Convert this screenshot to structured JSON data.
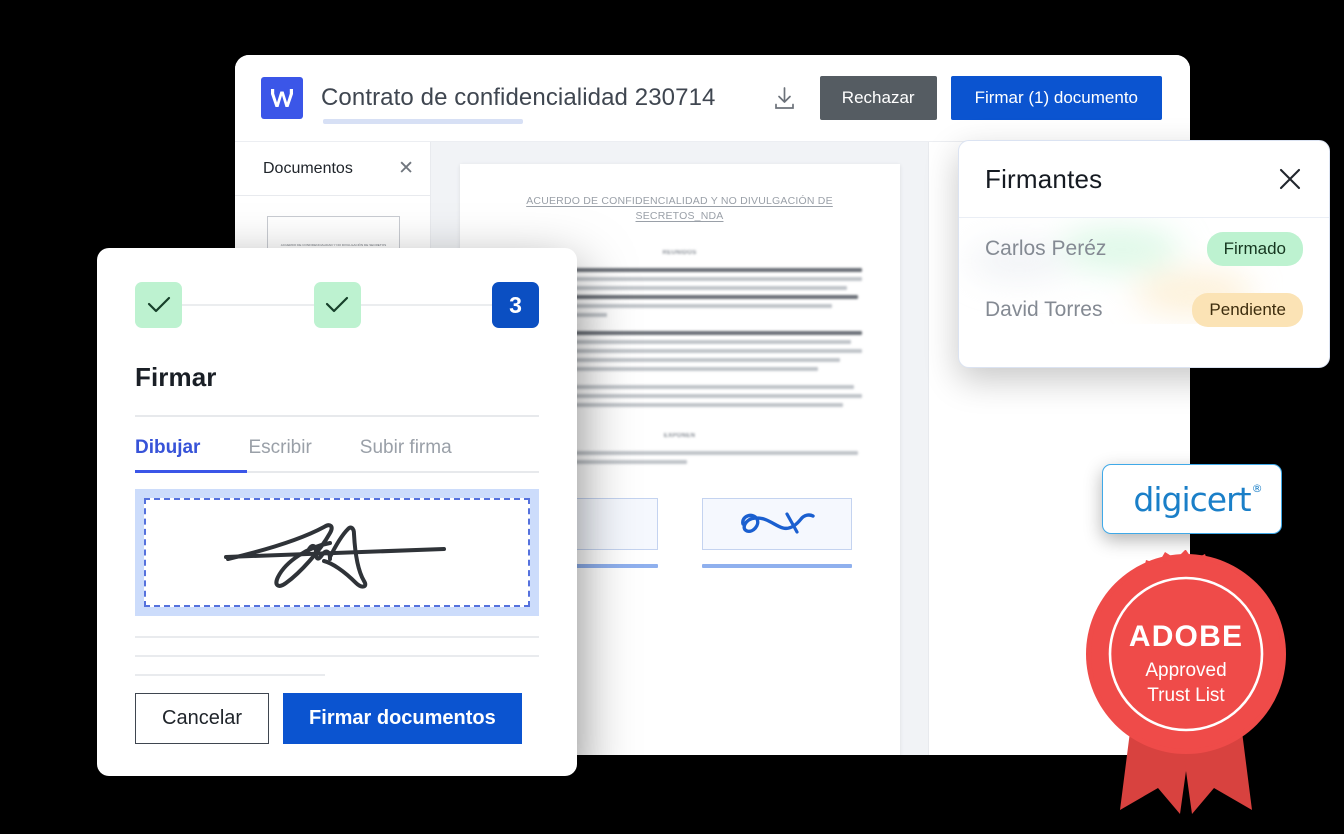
{
  "app": {
    "brand_icon": "w-logo-icon",
    "document_title": "Contrato de confidencialidad 230714",
    "download_icon": "download-icon",
    "reject_label": "Rechazar",
    "sign_label": "Firmar (1) documento",
    "accent_blue": "#0b54d0",
    "reject_gray": "#555c62",
    "brand_blue": "#3b56e8"
  },
  "sidebar": {
    "label": "Documentos",
    "close_icon": "close-icon",
    "thumbnail_text": "ACUERDO DE CONFIDENCIALIDAD Y NO DIVULGACIÓN DE SECRETOS NON-DISCLOSURE AGREEMENT (NDA)"
  },
  "document": {
    "title": "ACUERDO DE CONFIDENCIALIDAD Y NO DIVULGACIÓN DE SECRETOS_NDA",
    "section_1": "REUNIDOS",
    "section_2": "EXPONEN",
    "signature_field_empty": "",
    "signature_field_signed": "signature-mark"
  },
  "signers_panel": {
    "title": "Firmantes",
    "close_icon": "close-icon",
    "rows": [
      {
        "name": "Carlos Peréz",
        "status": "Firmado",
        "status_color": "#bdf2d0"
      },
      {
        "name": "David Torres",
        "status": "Pendiente",
        "status_color": "#fbe3b5"
      }
    ]
  },
  "sign_modal": {
    "steps": [
      {
        "state": "done",
        "icon": "check-icon",
        "label": ""
      },
      {
        "state": "done",
        "icon": "check-icon",
        "label": ""
      },
      {
        "state": "current",
        "icon": "",
        "label": "3"
      }
    ],
    "title": "Firmar",
    "tabs": [
      {
        "label": "Dibujar",
        "active": true
      },
      {
        "label": "Escribir",
        "active": false
      },
      {
        "label": "Subir firma",
        "active": false
      }
    ],
    "canvas_icon": "handwritten-signature",
    "cancel_label": "Cancelar",
    "submit_label": "Firmar documentos"
  },
  "badges": {
    "digicert": {
      "text": "digicert",
      "registered": "®",
      "color": "#1a7fc8"
    },
    "adobe_seal": {
      "line1": "ADOBE",
      "line2": "Approved",
      "line3": "Trust List",
      "color": "#ef4b49"
    }
  }
}
